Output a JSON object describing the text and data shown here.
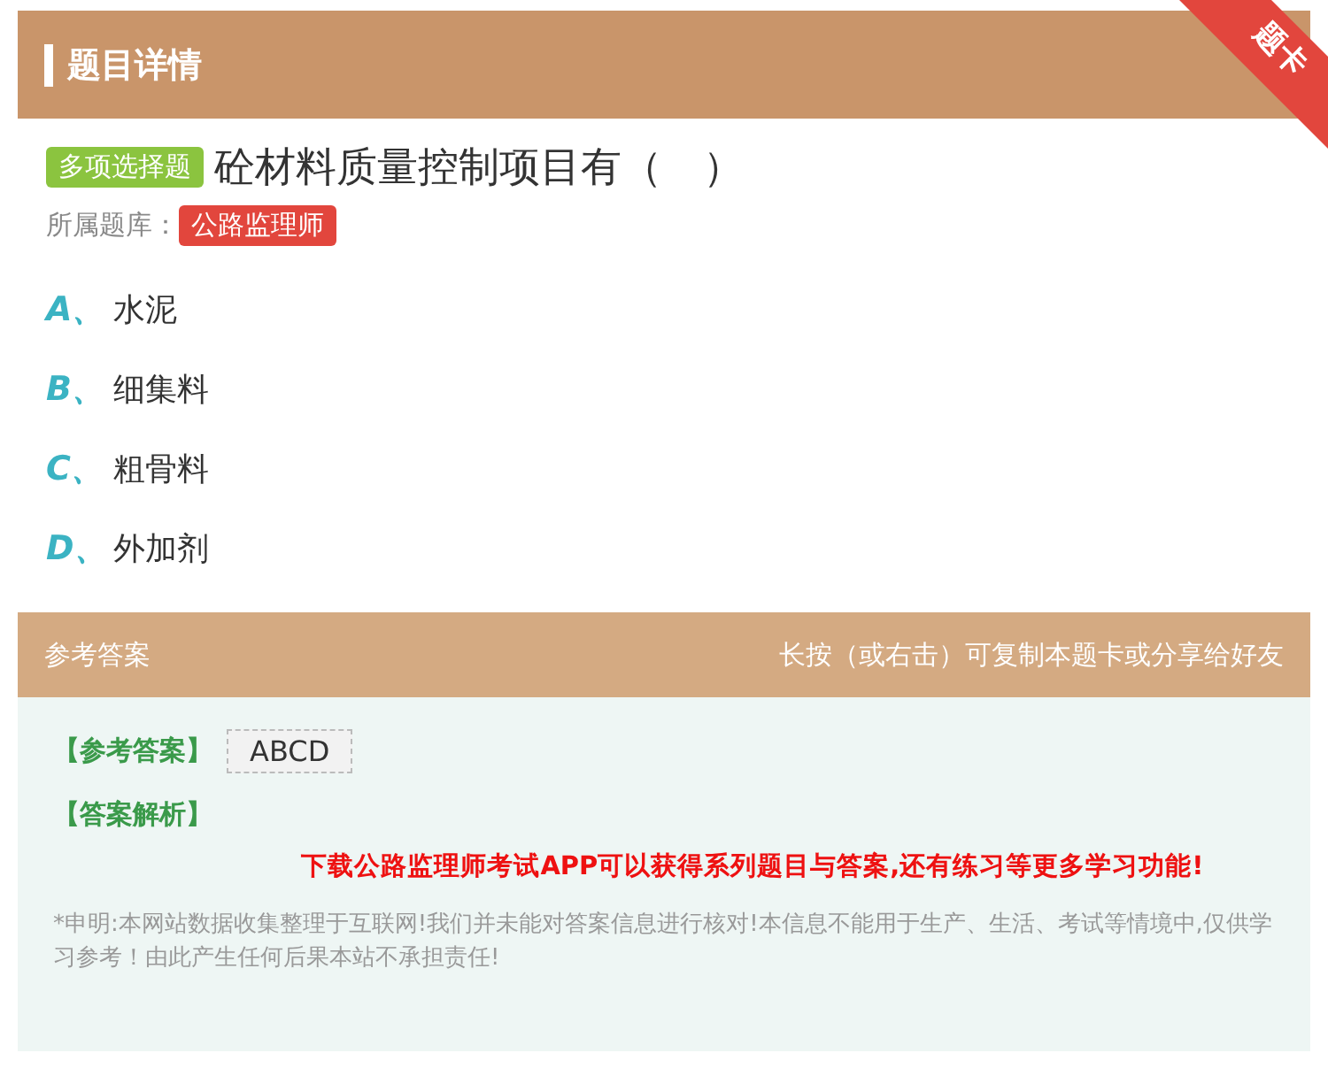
{
  "header": {
    "title": "题目详情",
    "ribbon": "题卡"
  },
  "question": {
    "type_tag": "多项选择题",
    "text": "砼材料质量控制项目有（　）",
    "bank_label": "所属题库：",
    "bank_tag": "公路监理师"
  },
  "options": [
    {
      "letter": "A、",
      "text": "水泥"
    },
    {
      "letter": "B、",
      "text": "细集料"
    },
    {
      "letter": "C、",
      "text": "粗骨料"
    },
    {
      "letter": "D、",
      "text": "外加剂"
    }
  ],
  "answer_bar": {
    "title": "参考答案",
    "hint": "长按（或右击）可复制本题卡或分享给好友"
  },
  "answer": {
    "answer_label": "【参考答案】",
    "answer_value": "ABCD",
    "analysis_label": "【答案解析】",
    "promo": "下载公路监理师考试APP可以获得系列题目与答案,还有练习等更多学习功能!",
    "disclaimer": "*申明:本网站数据收集整理于互联网!我们并未能对答案信息进行核对!本信息不能用于生产、生活、考试等情境中,仅供学习参考！由此产生任何后果本站不承担责任!"
  }
}
